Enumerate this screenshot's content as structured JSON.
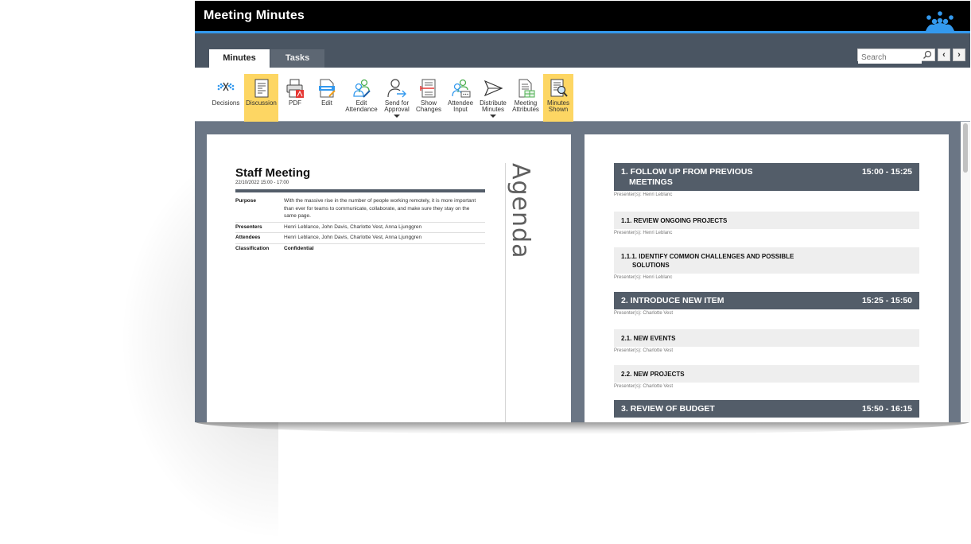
{
  "app": {
    "title": "Meeting Minutes",
    "logo_icon": "crown-people-icon",
    "accent_color": "#3399ee"
  },
  "tabs": [
    {
      "label": "Minutes",
      "active": true
    },
    {
      "label": "Tasks",
      "active": false
    }
  ],
  "search": {
    "placeholder": "Search",
    "value": ""
  },
  "nav": {
    "prev_glyph": "‹",
    "next_glyph": "›"
  },
  "ribbon": {
    "highlight_color": "#fdd663",
    "buttons": [
      {
        "label": "Decisions",
        "icon": "decisions-icon",
        "active": false,
        "dropdown": false
      },
      {
        "label": "Discussion",
        "icon": "document-lines-icon",
        "active": true,
        "dropdown": false
      },
      {
        "label": "PDF",
        "icon": "printer-pdf-icon",
        "active": false,
        "dropdown": false
      },
      {
        "label": "Edit",
        "icon": "edit-document-icon",
        "active": false,
        "dropdown": false
      },
      {
        "label": "Edit\nAttendance",
        "icon": "edit-attendance-icon",
        "active": false,
        "dropdown": false
      },
      {
        "label": "Send for\nApproval",
        "icon": "send-approval-icon",
        "active": false,
        "dropdown": true
      },
      {
        "label": "Show\nChanges",
        "icon": "show-changes-icon",
        "active": false,
        "dropdown": false
      },
      {
        "label": "Attendee\nInput",
        "icon": "attendee-input-icon",
        "active": false,
        "dropdown": false
      },
      {
        "label": "Distribute\nMinutes",
        "icon": "paper-plane-icon",
        "active": false,
        "dropdown": true
      },
      {
        "label": "Meeting\nAttributes",
        "icon": "meeting-attributes-icon",
        "active": false,
        "dropdown": false
      },
      {
        "label": "Minutes\nShown",
        "icon": "minutes-shown-icon",
        "active": true,
        "dropdown": false
      }
    ]
  },
  "meeting": {
    "title": "Staff Meeting",
    "datetime": "22/10/2022 15:00 - 17:00",
    "rows": [
      {
        "key": "Purpose",
        "value": "With the massive rise in the number of people working remotely, it is more important than ever for teams to communicate, collaborate, and make sure they stay on the same page.",
        "bold": false
      },
      {
        "key": "Presenters",
        "value": "Henri Leblance, John Davis, Charlotte Vest, Anna Ljunggren",
        "bold": false
      },
      {
        "key": "Attendees",
        "value": "Henri Leblance, John Davis, Charlotte Vest, Anna Ljunggren",
        "bold": false
      },
      {
        "key": "Classification",
        "value": "Confidential",
        "bold": true
      }
    ],
    "side_heading": "Agenda"
  },
  "agenda": {
    "header_color": "#535d69",
    "items": [
      {
        "level": 1,
        "line1": "1. FOLLOW UP FROM PREVIOUS",
        "line2": "MEETINGS",
        "time": "15:00 - 15:25",
        "presenter": "Presenter(s): Henri Leblanc"
      },
      {
        "level": 2,
        "line1": "1.1. REVIEW ONGOING PROJECTS",
        "line2": "",
        "time": "",
        "presenter": "Presenter(s): Henri Leblanc"
      },
      {
        "level": 3,
        "line1": "1.1.1. IDENTIFY COMMON CHALLENGES AND POSSIBLE",
        "line2": "SOLUTIONS",
        "time": "",
        "presenter": "Presenter(s): Henri Leblanc"
      },
      {
        "level": 1,
        "line1": "2. INTRODUCE NEW ITEM",
        "line2": "",
        "time": "15:25 - 15:50",
        "presenter": "Presenter(s): Charlotte Vest"
      },
      {
        "level": 2,
        "line1": "2.1. NEW EVENTS",
        "line2": "",
        "time": "",
        "presenter": "Presenter(s): Charlotte Vest"
      },
      {
        "level": 2,
        "line1": "2.2. NEW PROJECTS",
        "line2": "",
        "time": "",
        "presenter": "Presenter(s): Charlotte Vest"
      },
      {
        "level": 1,
        "line1": "3. REVIEW OF BUDGET",
        "line2": "",
        "time": "15:50 - 16:15",
        "presenter": ""
      }
    ]
  }
}
